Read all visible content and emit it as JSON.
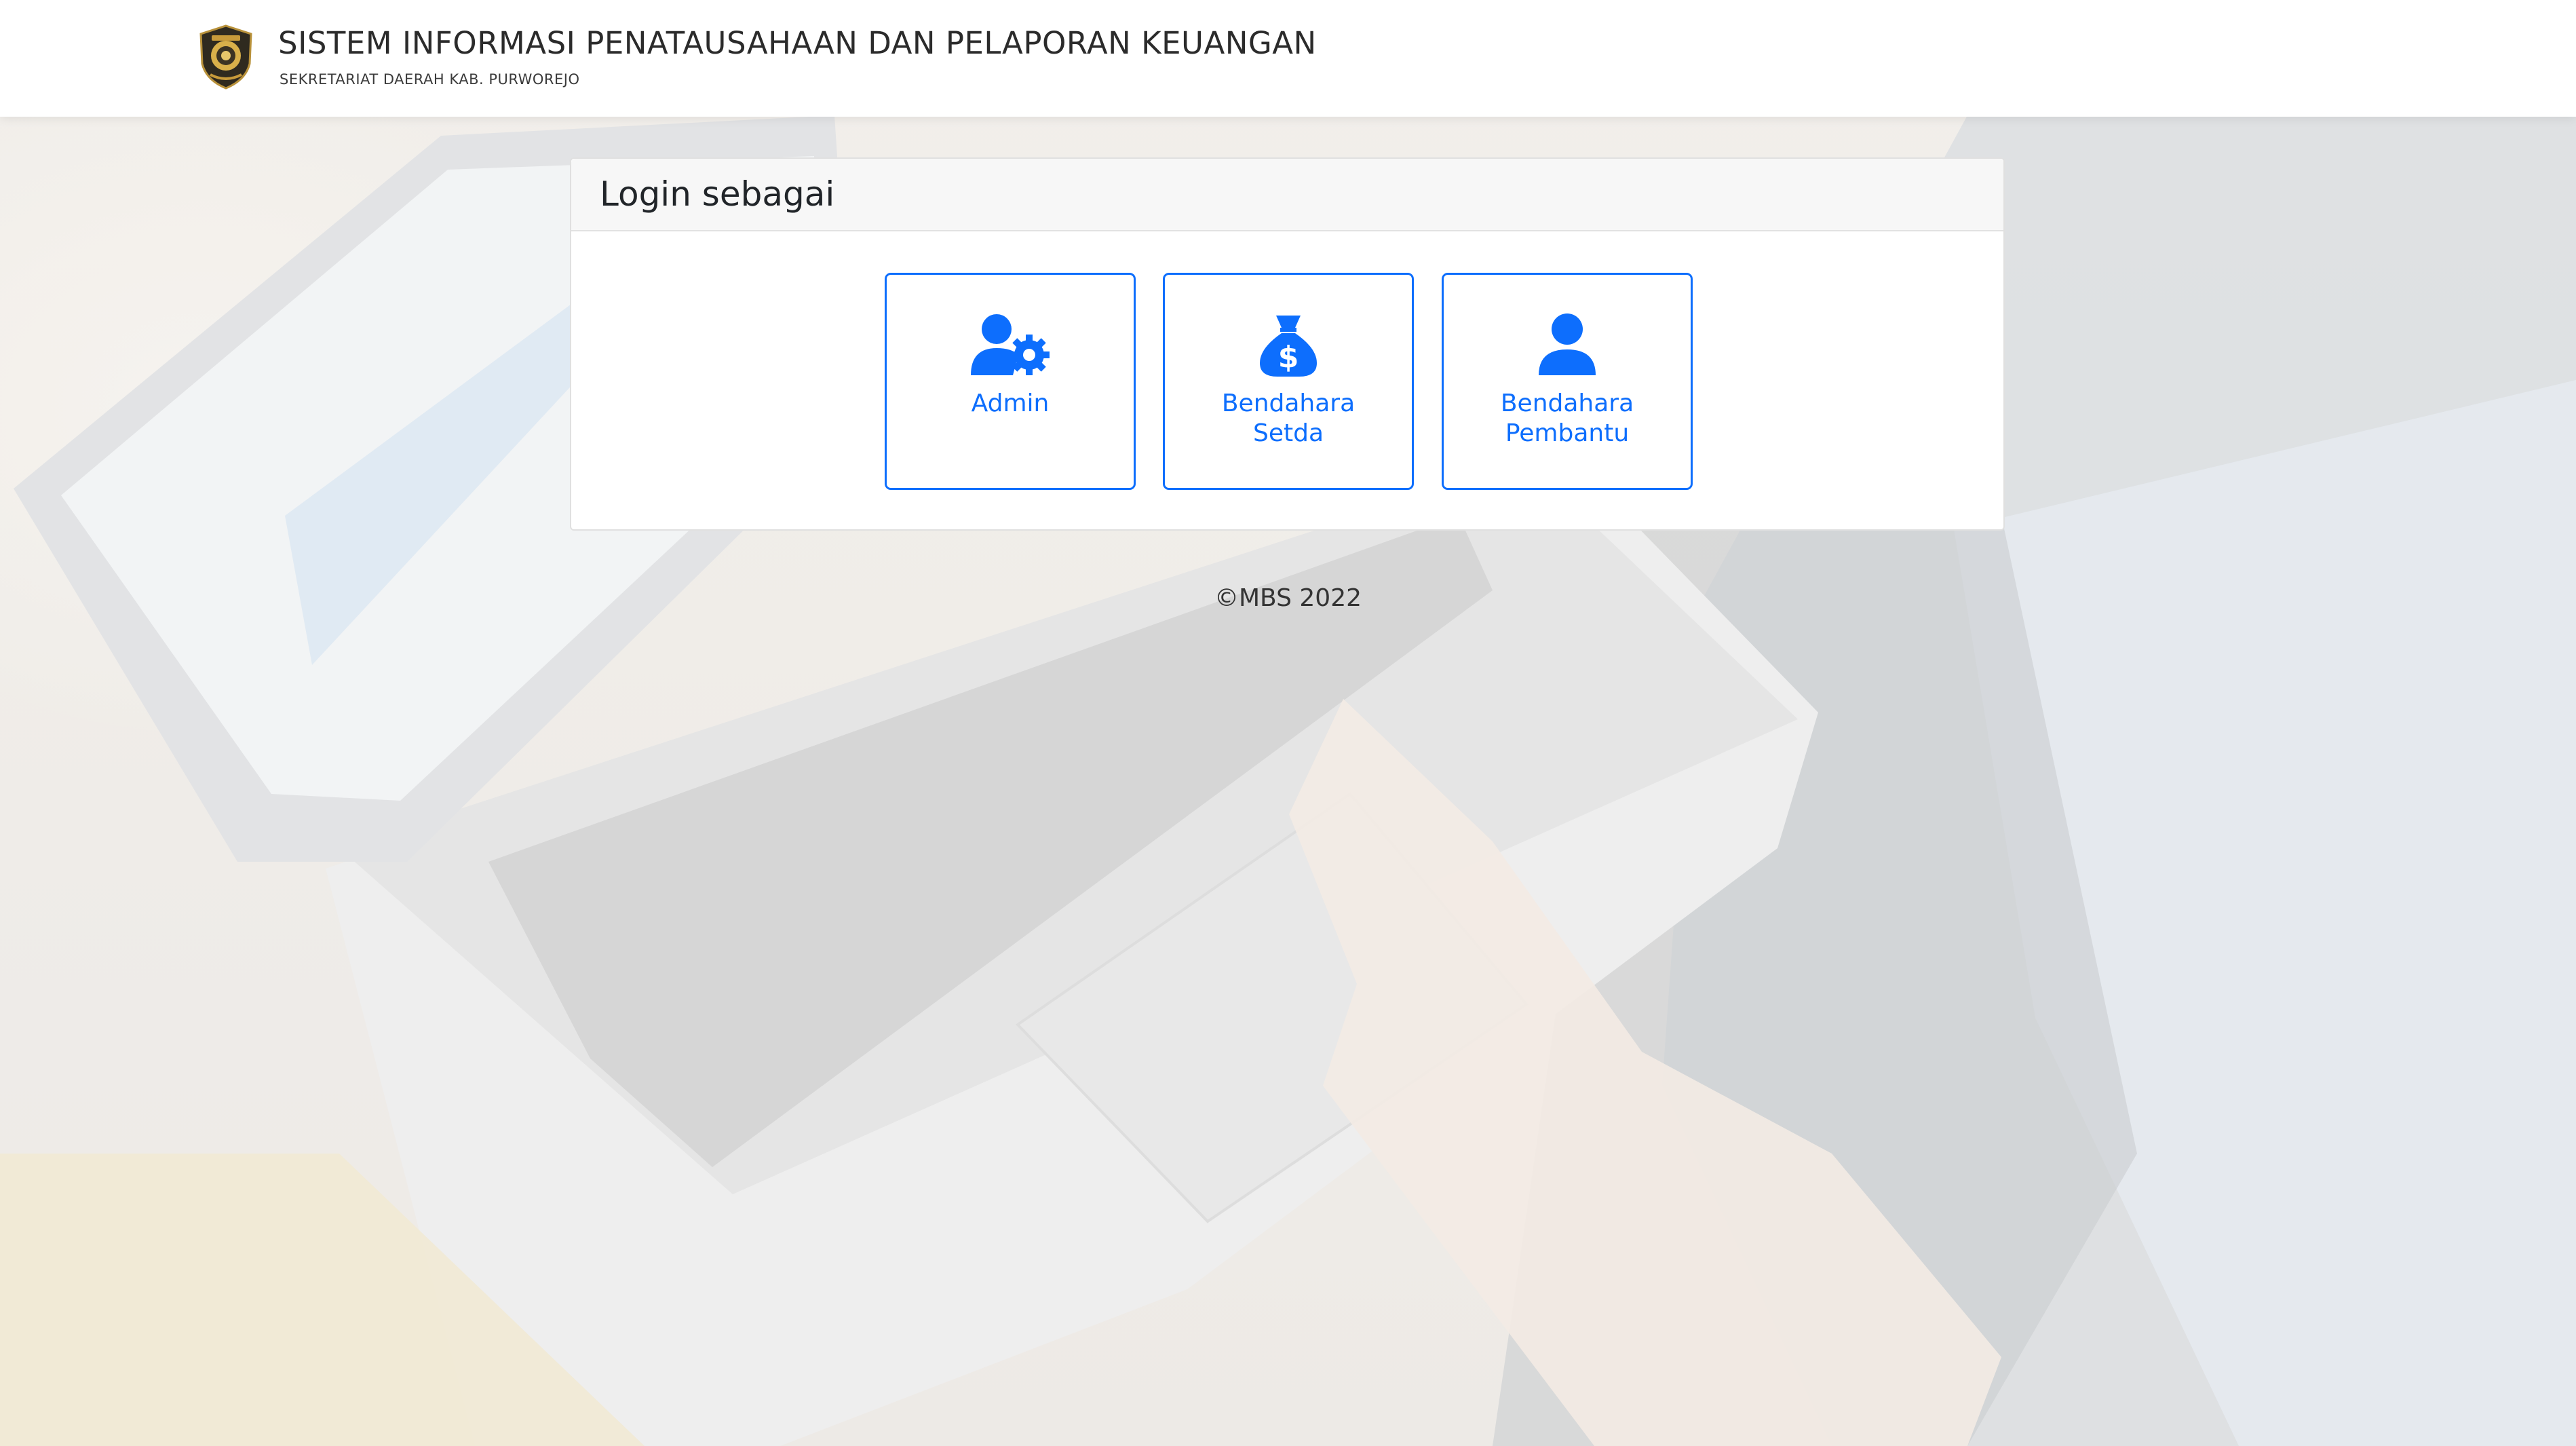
{
  "header": {
    "title": "SISTEM INFORMASI PENATAUSAHAAN DAN PELAPORAN KEUANGAN",
    "subtitle": "SEKRETARIAT DAERAH KAB. PURWOREJO",
    "logo_icon": "regency-emblem-icon"
  },
  "login": {
    "title": "Login sebagai",
    "roles": [
      {
        "line1": "Admin",
        "line2": "",
        "icon": "user-gear-icon"
      },
      {
        "line1": "Bendahara",
        "line2": "Setda",
        "icon": "money-bag-icon"
      },
      {
        "line1": "Bendahara",
        "line2": "Pembantu",
        "icon": "user-icon"
      }
    ]
  },
  "footer": {
    "copyright": "©MBS 2022"
  },
  "colors": {
    "accent": "#0d6efd",
    "header_bg": "#ffffff",
    "card_header_bg": "#f7f7f7",
    "text": "#212529"
  },
  "background": {
    "description_icon": "laptop-photo-background"
  }
}
